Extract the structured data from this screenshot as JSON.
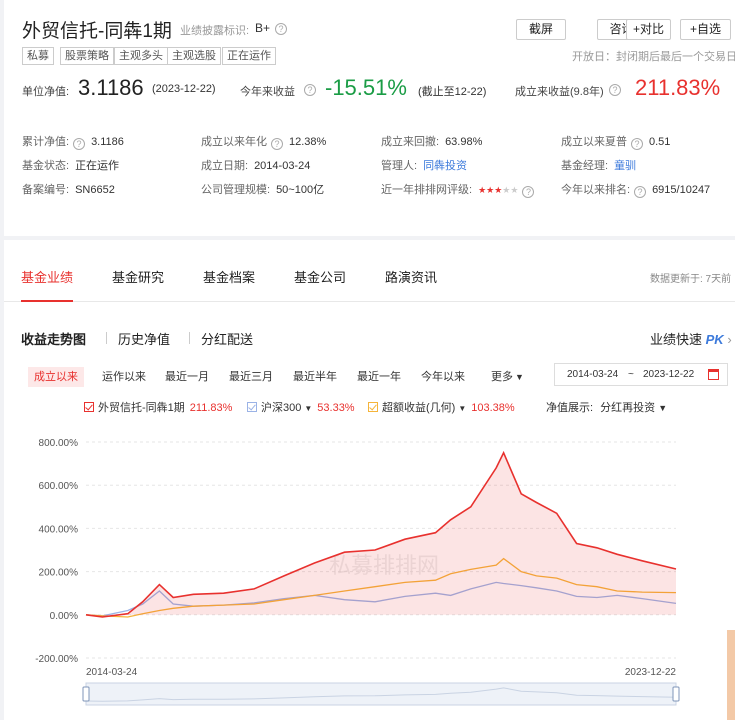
{
  "fund": {
    "name": "外贸信托-同犇1期",
    "disclosure_label": "业绩披露标识:",
    "disclosure_grade": "B+",
    "tags": [
      "私募",
      "股票策略",
      "主观多头",
      "主观选股",
      "正在运作"
    ],
    "buttons": [
      "截屏",
      "咨询",
      "+对比",
      "+自选"
    ],
    "open_day": "开放日：封闭期后最后一个交易日/月"
  },
  "headline": {
    "nav_label": "单位净值:",
    "nav_value": "3.1186",
    "nav_date": "(2023-12-22)",
    "ytd_label": "今年来收益",
    "ytd_value": "-15.51%",
    "ytd_note": "(截止至12-22)",
    "since_label": "成立来收益(9.8年)",
    "since_value": "211.83%"
  },
  "info": {
    "rows": [
      [
        {
          "label": "累计净值:",
          "value": "3.1186",
          "q": true
        },
        {
          "label": "成立以来年化",
          "value": "12.38%",
          "q": true,
          "red": true
        },
        {
          "label": "成立来回撤:",
          "value": "63.98%"
        },
        {
          "label": "成立以来夏普",
          "value": "0.51",
          "q": true
        }
      ],
      [
        {
          "label": "基金状态:",
          "value": "正在运作"
        },
        {
          "label": "成立日期:",
          "value": "2014-03-24"
        },
        {
          "label": "管理人:",
          "value": "同犇投资",
          "link": true
        },
        {
          "label": "基金经理:",
          "value": "童驯",
          "link": true
        }
      ],
      [
        {
          "label": "备案编号:",
          "value": "SN6652"
        },
        {
          "label": "公司管理规模:",
          "value": "50~100亿"
        },
        {
          "label": "近一年排排网评级:",
          "value": "",
          "stars": 3
        },
        {
          "label": "今年以来排名:",
          "value": "6915/10247",
          "q": true
        }
      ]
    ]
  },
  "tabs": [
    "基金业绩",
    "基金研究",
    "基金档案",
    "基金公司",
    "路演资讯"
  ],
  "updated": "数据更新于: 7天前",
  "subtabs": [
    "收益走势图",
    "历史净值",
    "分红配送"
  ],
  "pk": {
    "label": "业绩快速",
    "badge": "PK"
  },
  "periods": [
    "成立以来",
    "运作以来",
    "最近一月",
    "最近三月",
    "最近半年",
    "最近一年",
    "今年以来",
    "更多"
  ],
  "date_range": {
    "from": "2014-03-24",
    "sep": "~",
    "to": "2023-12-22"
  },
  "legend": [
    {
      "name": "外贸信托-同犇1期",
      "value": "211.83%",
      "color": "#e8312e"
    },
    {
      "name": "沪深300",
      "value": "53.33%",
      "color": "#9bb3e6",
      "dropdown": true
    },
    {
      "name": "超额收益(几何)",
      "value": "103.38%",
      "color": "#f5b43a",
      "dropdown": true
    }
  ],
  "nav_display": {
    "label": "净值展示:",
    "value": "分红再投资"
  },
  "colors": {
    "accent": "#e8312e",
    "fund": "#e8312e",
    "index": "#9bb3e6",
    "excess": "#f5b43a"
  },
  "chart_data": {
    "type": "line",
    "yticks": [
      "800.00%",
      "600.00%",
      "400.00%",
      "200.00%",
      "0.00%",
      "-200.00%"
    ],
    "ylim": [
      -200,
      800
    ],
    "xlim": [
      "2014-03-24",
      "2023-12-22"
    ],
    "xticks": [
      "2014-03-24",
      "2023-12-22"
    ],
    "watermark": "私募排排网",
    "series": [
      {
        "name": "外贸信托-同犇1期",
        "color": "#e8312e",
        "area": true,
        "x": [
          "2014-03-24",
          "2014-07-01",
          "2014-12-01",
          "2015-03-01",
          "2015-06-10",
          "2015-09-01",
          "2016-01-01",
          "2016-07-01",
          "2017-01-01",
          "2017-07-01",
          "2018-01-01",
          "2018-07-01",
          "2019-01-01",
          "2019-07-01",
          "2020-01-01",
          "2020-04-01",
          "2020-08-01",
          "2021-01-01",
          "2021-02-15",
          "2021-06-01",
          "2021-09-01",
          "2022-01-01",
          "2022-05-01",
          "2022-09-01",
          "2023-01-01",
          "2023-06-01",
          "2023-12-22"
        ],
        "values": [
          0,
          -10,
          5,
          60,
          140,
          80,
          95,
          100,
          120,
          180,
          240,
          290,
          300,
          350,
          380,
          440,
          500,
          680,
          750,
          560,
          520,
          470,
          330,
          310,
          280,
          250,
          212
        ]
      },
      {
        "name": "沪深300",
        "color": "#9bb3e6",
        "area": false,
        "x": [
          "2014-03-24",
          "2014-07-01",
          "2014-12-01",
          "2015-03-01",
          "2015-06-10",
          "2015-09-01",
          "2016-01-01",
          "2016-07-01",
          "2017-01-01",
          "2017-07-01",
          "2018-01-01",
          "2018-07-01",
          "2019-01-01",
          "2019-07-01",
          "2020-01-01",
          "2020-04-01",
          "2020-08-01",
          "2021-01-01",
          "2021-02-15",
          "2021-06-01",
          "2021-09-01",
          "2022-01-01",
          "2022-05-01",
          "2022-09-01",
          "2023-01-01",
          "2023-06-01",
          "2023-12-22"
        ],
        "values": [
          0,
          -5,
          20,
          50,
          110,
          50,
          40,
          45,
          55,
          75,
          90,
          70,
          60,
          85,
          100,
          90,
          120,
          150,
          145,
          135,
          125,
          110,
          85,
          80,
          90,
          75,
          53
        ]
      },
      {
        "name": "超额收益(几何)",
        "color": "#f5b43a",
        "area": false,
        "x": [
          "2014-03-24",
          "2014-07-01",
          "2014-12-01",
          "2015-03-01",
          "2015-06-10",
          "2015-09-01",
          "2016-01-01",
          "2016-07-01",
          "2017-01-01",
          "2017-07-01",
          "2018-01-01",
          "2018-07-01",
          "2019-01-01",
          "2019-07-01",
          "2020-01-01",
          "2020-04-01",
          "2020-08-01",
          "2021-01-01",
          "2021-02-15",
          "2021-06-01",
          "2021-09-01",
          "2022-01-01",
          "2022-05-01",
          "2022-09-01",
          "2023-01-01",
          "2023-06-01",
          "2023-12-22"
        ],
        "values": [
          0,
          -5,
          -10,
          5,
          20,
          30,
          40,
          45,
          50,
          70,
          90,
          110,
          130,
          150,
          160,
          190,
          210,
          230,
          260,
          200,
          180,
          170,
          140,
          130,
          110,
          105,
          103
        ]
      }
    ]
  }
}
